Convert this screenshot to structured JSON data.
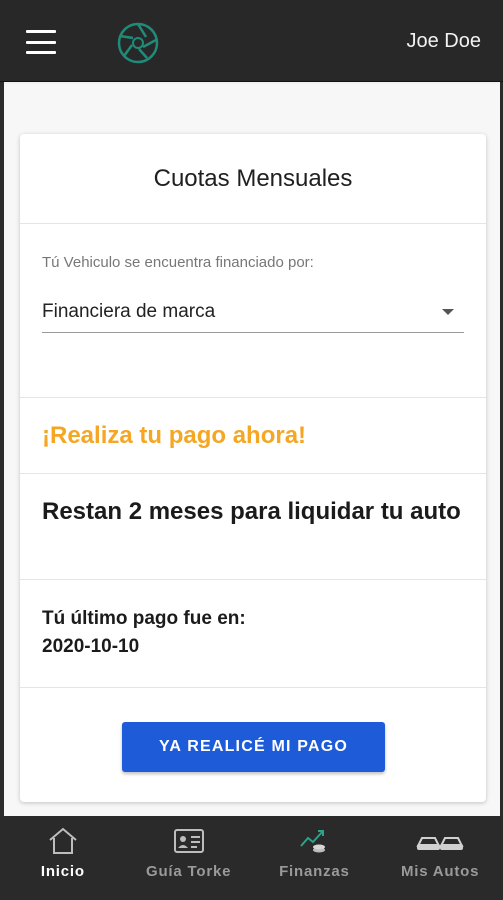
{
  "header": {
    "user_name": "Joe Doe",
    "menu_icon": "hamburger-menu-icon",
    "logo_icon": "aperture-logo-icon"
  },
  "card": {
    "title": "Cuotas Mensuales",
    "finance_label": "Tú Vehiculo se encuentra financiado por:",
    "finance_select_value": "Financiera de marca",
    "promo_text": "¡Realiza tu pago ahora!",
    "remaining_text": "Restan 2 meses para liquidar tu auto",
    "last_payment_label": "Tú último pago fue en:",
    "last_payment_date": "2020-10-10",
    "pay_button_label": "YA REALICÉ MI PAGO"
  },
  "colors": {
    "accent_orange": "#f5a623",
    "button_blue": "#1e5bd8",
    "bar_dark": "#282828"
  },
  "nav": {
    "items": [
      {
        "label": "Inicio",
        "icon": "home-icon",
        "active": true
      },
      {
        "label": "Guía Torke",
        "icon": "id-card-icon",
        "active": false
      },
      {
        "label": "Finanzas",
        "icon": "finance-chart-icon",
        "active": false
      },
      {
        "label": "Mis Autos",
        "icon": "cars-icon",
        "active": false
      }
    ]
  }
}
